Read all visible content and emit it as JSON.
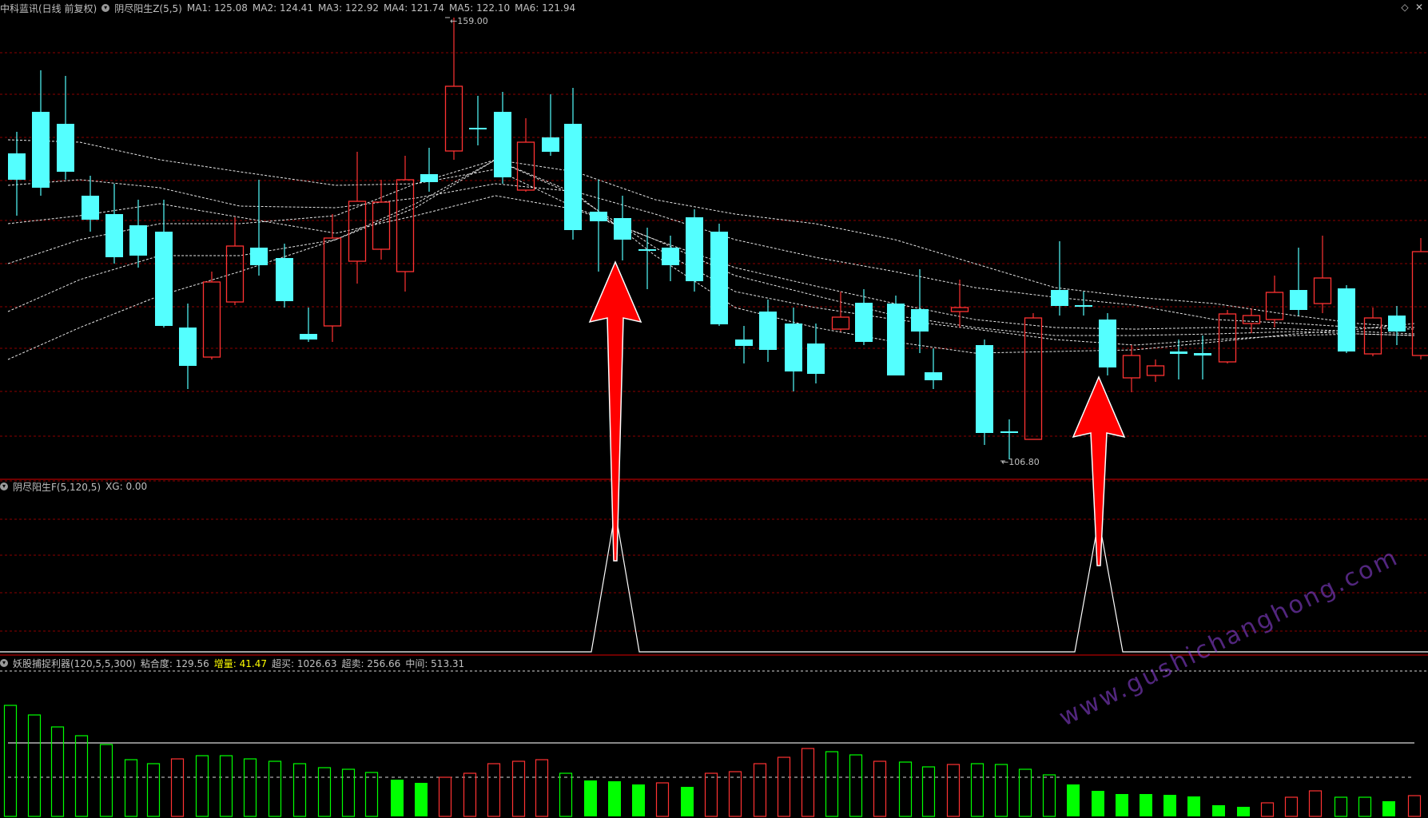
{
  "panel1": {
    "stock": "中科蓝讯(日线 前复权)",
    "indicator": "阴尽阳生Z(5,5)",
    "ma": [
      "MA1: 125.08",
      "MA2: 124.41",
      "MA3: 122.92",
      "MA4: 121.74",
      "MA5: 122.10",
      "MA6: 121.94"
    ],
    "high_label": "159.00",
    "low_label": "106.80"
  },
  "panel2": {
    "indicator": "阴尽阳生F(5,120,5)",
    "xg": "XG: 0.00"
  },
  "panel3": {
    "indicator": "妖股捕捉利器(120,5,5,300)",
    "fit": "粘合度: 129.56",
    "increase": "增量: 41.47",
    "overbought": "超买: 1026.63",
    "oversold": "超卖: 256.66",
    "middle": "中间: 513.31"
  },
  "watermark": "www.gushichanghong.com",
  "icons": {
    "expand": "diamond-icon",
    "close": "close-icon"
  },
  "colors": {
    "up": "#ff3232",
    "down": "#54ffff",
    "vol_down": "#00ff00",
    "grid": "#8b0000",
    "arrow": "#ff0000"
  }
}
